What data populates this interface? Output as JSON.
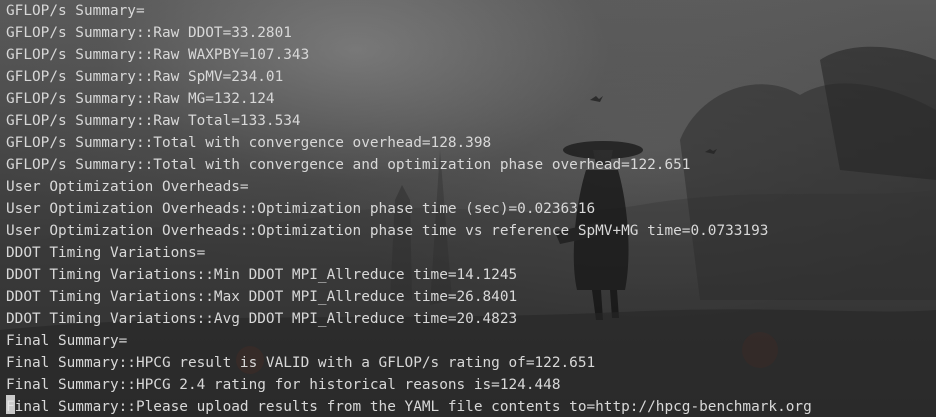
{
  "terminal": {
    "lines": [
      "GFLOP/s Summary=",
      "GFLOP/s Summary::Raw DDOT=33.2801",
      "GFLOP/s Summary::Raw WAXPBY=107.343",
      "GFLOP/s Summary::Raw SpMV=234.01",
      "GFLOP/s Summary::Raw MG=132.124",
      "GFLOP/s Summary::Raw Total=133.534",
      "GFLOP/s Summary::Total with convergence overhead=128.398",
      "GFLOP/s Summary::Total with convergence and optimization phase overhead=122.651",
      "User Optimization Overheads=",
      "User Optimization Overheads::Optimization phase time (sec)=0.0236316",
      "User Optimization Overheads::Optimization phase time vs reference SpMV+MG time=0.0733193",
      "DDOT Timing Variations=",
      "DDOT Timing Variations::Min DDOT MPI_Allreduce time=14.1245",
      "DDOT Timing Variations::Max DDOT MPI_Allreduce time=26.8401",
      "DDOT Timing Variations::Avg DDOT MPI_Allreduce time=20.4823",
      "Final Summary=",
      "Final Summary::HPCG result is VALID with a GFLOP/s rating of=122.651",
      "Final Summary::HPCG 2.4 rating for historical reasons is=124.448",
      "Final Summary::Please upload results from the YAML file contents to=http://hpcg-benchmark.org"
    ]
  }
}
